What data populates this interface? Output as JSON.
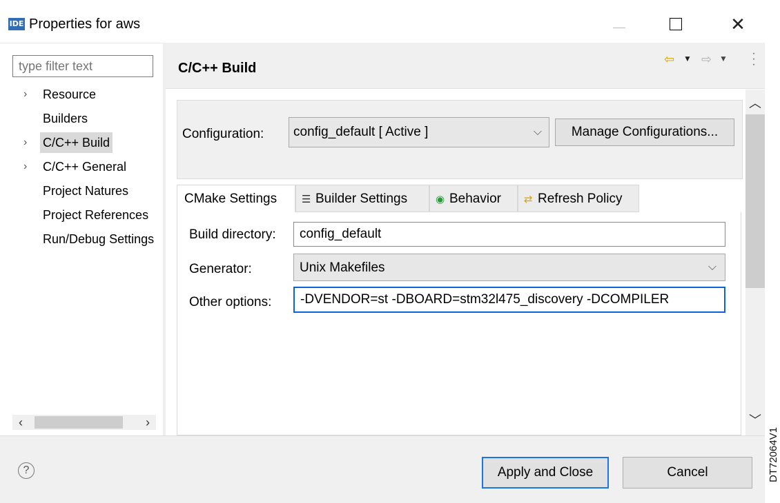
{
  "window": {
    "icon_text": "IDE",
    "title": "Properties for aws"
  },
  "sidebar": {
    "filter_placeholder": "type filter text",
    "items": [
      {
        "label": "Resource",
        "expandable": true,
        "selected": false
      },
      {
        "label": "Builders",
        "expandable": false,
        "selected": false
      },
      {
        "label": "C/C++ Build",
        "expandable": true,
        "selected": true
      },
      {
        "label": "C/C++ General",
        "expandable": true,
        "selected": false
      },
      {
        "label": "Project Natures",
        "expandable": false,
        "selected": false
      },
      {
        "label": "Project References",
        "expandable": false,
        "selected": false
      },
      {
        "label": "Run/Debug Settings",
        "expandable": false,
        "selected": false
      }
    ]
  },
  "page": {
    "title": "C/C++ Build"
  },
  "configuration": {
    "label": "Configuration:",
    "value": "config_default  [ Active ]",
    "manage_button": "Manage Configurations..."
  },
  "tabs": [
    {
      "label": "CMake Settings",
      "icon": "none",
      "active": true
    },
    {
      "label": "Builder Settings",
      "icon": "list-icon",
      "active": false
    },
    {
      "label": "Behavior",
      "icon": "radio-icon",
      "active": false
    },
    {
      "label": "Refresh Policy",
      "icon": "refresh-icon",
      "active": false
    }
  ],
  "cmake": {
    "build_dir_label": "Build directory:",
    "build_dir_value": "config_default",
    "generator_label": "Generator:",
    "generator_value": "Unix Makefiles",
    "other_options_label": "Other options:",
    "other_options_value": "-DVENDOR=st -DBOARD=stm32l475_discovery -DCOMPILER"
  },
  "footer": {
    "apply_label": "Apply and Close",
    "cancel_label": "Cancel"
  },
  "doc_id": "DT72064V1",
  "colors": {
    "accent_blue": "#1a73e8",
    "back_arrow": "#d9a400",
    "logo_bg": "#2f6db5"
  }
}
